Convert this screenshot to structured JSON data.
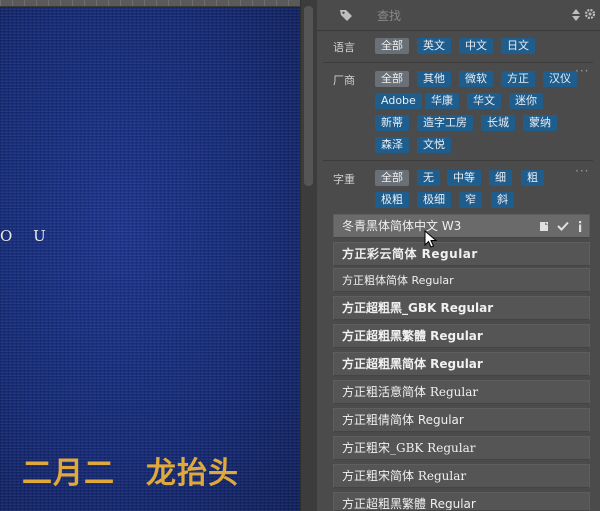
{
  "canvas": {
    "letters": "O U",
    "title": "二月二　龙抬头"
  },
  "search": {
    "placeholder": "查找"
  },
  "filters": {
    "language": {
      "label": "语言",
      "tags": [
        "全部",
        "英文",
        "中文",
        "日文"
      ],
      "selected": "全部"
    },
    "vendor": {
      "label": "厂商",
      "tags": [
        "全部",
        "其他",
        "微软",
        "方正",
        "汉仪",
        "Adobe",
        "华康",
        "华文",
        "迷你",
        "新蒂",
        "造字工房",
        "长城",
        "蒙纳",
        "森泽",
        "文悦"
      ],
      "selected": "全部"
    },
    "weight": {
      "label": "字重",
      "tags": [
        "全部",
        "无",
        "中等",
        "细",
        "粗",
        "极粗",
        "极细",
        "窄",
        "斜"
      ],
      "selected": "全部"
    }
  },
  "fonts": [
    "冬青黑体简体中文 W3",
    "方正彩云简体 Regular",
    "方正粗体简体 Regular",
    "方正超粗黑_GBK Regular",
    "方正超粗黑繁體 Regular",
    "方正超粗黑简体 Regular",
    "方正粗活意简体 Regular",
    "方正粗倩简体 Regular",
    "方正粗宋_GBK Regular",
    "方正粗宋简体 Regular",
    "方正超粗黑繁體 Regular"
  ],
  "colors": {
    "tag": "#1f5d8c",
    "tag_selected": "#6a7078",
    "canvas_blue": "#142a7a",
    "title_gold": "#e0a93a"
  },
  "icons": {
    "tag": "tag-icon",
    "sort": "sort-icon",
    "settings": "gear-icon",
    "note": "note-icon",
    "check": "check-icon",
    "info": "info-icon",
    "more": "more-icon",
    "cursor": "cursor-icon"
  }
}
